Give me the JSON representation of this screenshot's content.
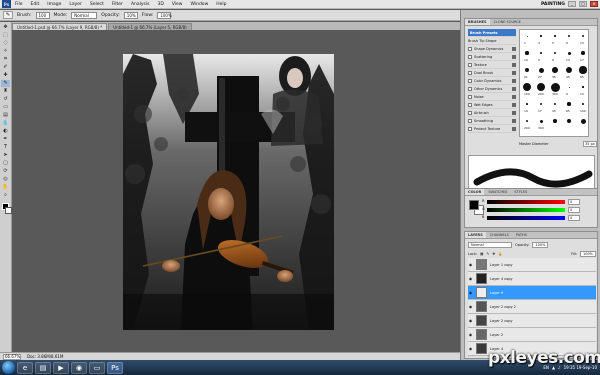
{
  "app": {
    "logo": "Ps",
    "workspace": "PAINTING"
  },
  "menu": [
    "File",
    "Edit",
    "Image",
    "Layer",
    "Select",
    "Filter",
    "Analysis",
    "3D",
    "View",
    "Window",
    "Help"
  ],
  "options": {
    "brush_label": "Brush:",
    "brush_size": "100",
    "mode_label": "Mode:",
    "mode_value": "Normal",
    "opacity_label": "Opacity:",
    "opacity_value": "10%",
    "flow_label": "Flow:",
    "flow_value": "100%"
  },
  "tabs": [
    {
      "label": "Untitled-1.psd @ 66.7% (Layer 9, RGB/8) *",
      "active": true
    },
    {
      "label": "Untitled-1 @ 66.7% (Layer 5, RGB/8)",
      "active": false
    }
  ],
  "tools": [
    "move",
    "marquee",
    "lasso",
    "quick-select",
    "crop",
    "eyedropper",
    "healing",
    "brush",
    "stamp",
    "history-brush",
    "eraser",
    "gradient",
    "blur",
    "dodge",
    "pen",
    "type",
    "path-select",
    "shape",
    "3d-rotate",
    "3d-orbit",
    "hand",
    "zoom"
  ],
  "status": {
    "zoom": "66.67%",
    "doc": "Doc: 3.86M/8.61M"
  },
  "brushes": {
    "tabs": [
      "BRUSHES",
      "CLONE SOURCE"
    ],
    "presets_label": "Brush Presets",
    "options": [
      "Brush Tip Shape",
      "Shape Dynamics",
      "Scattering",
      "Texture",
      "Dual Brush",
      "Color Dynamics",
      "Other Dynamics",
      "Noise",
      "Wet Edges",
      "Airbrush",
      "Smoothing",
      "Protect Texture"
    ],
    "master_label": "Master Diameter",
    "master_value": "35 px",
    "tip_numbers": [
      "1",
      "3",
      "5",
      "9",
      "13",
      "19",
      "5",
      "9",
      "13",
      "17",
      "21",
      "27",
      "35",
      "45",
      "65",
      "100",
      "200",
      "300",
      "9",
      "13",
      "19",
      "17",
      "45",
      "65",
      "100",
      "200",
      "300"
    ]
  },
  "color": {
    "tabs": [
      "COLOR",
      "SWATCHES",
      "STYLES"
    ],
    "channels": [
      {
        "label": "R",
        "value": "0"
      },
      {
        "label": "G",
        "value": "0"
      },
      {
        "label": "B",
        "value": "0"
      }
    ]
  },
  "layers": {
    "tabs": [
      "LAYERS",
      "CHANNELS",
      "PATHS"
    ],
    "blend": "Normal",
    "opacity_label": "Opacity:",
    "opacity": "100%",
    "lock_label": "Lock:",
    "fill_label": "Fill:",
    "fill": "100%",
    "items": [
      {
        "name": "Layer 1 copy",
        "active": false,
        "thumb": "#777"
      },
      {
        "name": "Layer 4 copy",
        "active": false,
        "thumb": "#222"
      },
      {
        "name": "Layer 9",
        "active": true,
        "thumb": "#eee"
      },
      {
        "name": "Layer 2 copy 2",
        "active": false,
        "thumb": "#555"
      },
      {
        "name": "Layer 2 copy",
        "active": false,
        "thumb": "#444"
      },
      {
        "name": "Layer 2",
        "active": false,
        "thumb": "#666"
      },
      {
        "name": "Layer 4",
        "active": false,
        "thumb": "#3a3a3a"
      }
    ]
  },
  "taskbar": {
    "lang": "EN",
    "time": "19:35",
    "date": "19-Sep-10"
  },
  "watermark": "pxleyes.com",
  "colors": {
    "accent": "#3399ff",
    "layer_selected": "#3399ff",
    "panel_header": "#3b78c7"
  }
}
